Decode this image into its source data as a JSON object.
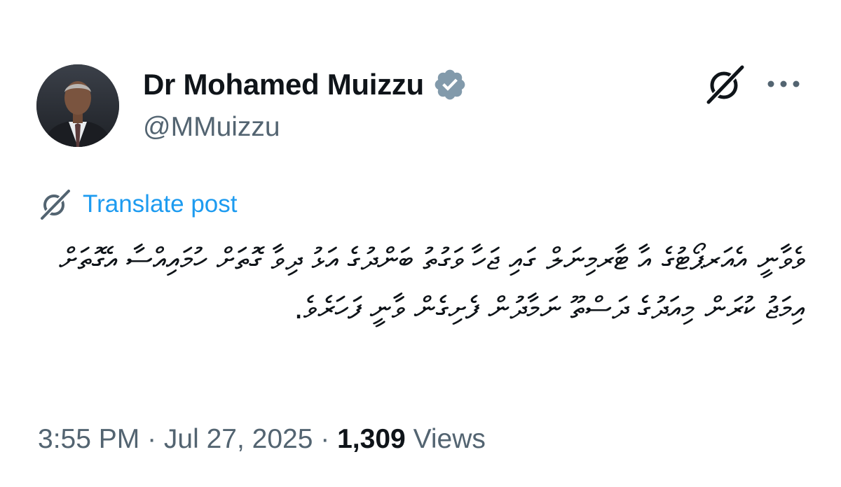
{
  "author": {
    "display_name": "Dr Mohamed Muizzu",
    "handle": "@MMuizzu",
    "verified": true,
    "verified_color": "#829aab"
  },
  "icons": {
    "avatar": "profile-photo",
    "verified": "verified-badge-icon",
    "grok": "grok-icon",
    "more": "more-icon",
    "translate": "translate-icon"
  },
  "translate": {
    "label": "Translate post",
    "color": "#1d9bf0"
  },
  "post": {
    "text": "ވެވާނީ އެއަރޕޯޓުގެ އާ ޓާރމިނަލް ގައި ޖަހާ ވަގުތު ބަންދުގެ އަޅު ދިވާ ގޮތަށް ހުމައިއްސާ އެގޮތަށް އިމަޖު ކުރަން މިއަދުގެ ދަސްތޫ ނަމާދުން ފެށިގެން ވާނީ ފަހަރެވެ."
  },
  "meta": {
    "time": "3:55 PM",
    "separator": " · ",
    "date": "Jul 27, 2025",
    "views_count": "1,309",
    "views_label": "Views"
  }
}
